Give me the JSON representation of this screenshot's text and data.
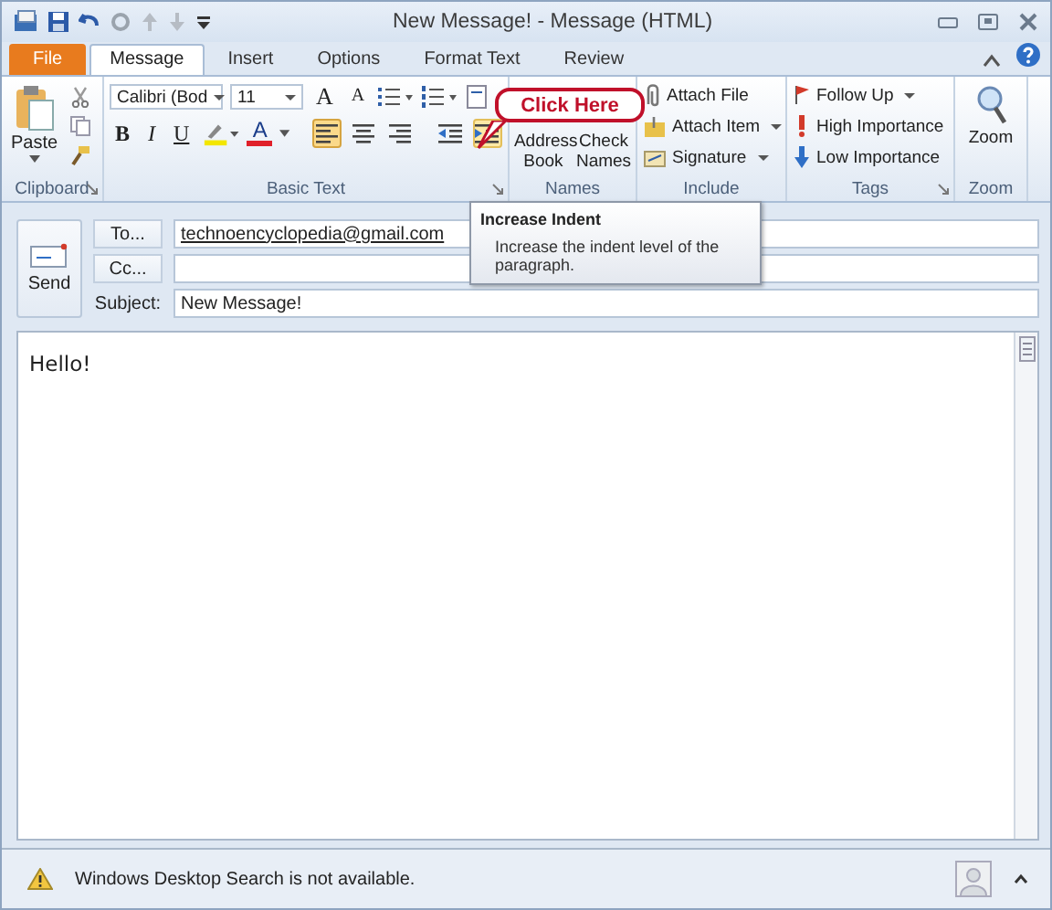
{
  "window": {
    "title": "New Message!  -  Message (HTML)"
  },
  "tabs": [
    {
      "label": "File",
      "kind": "file",
      "selected": false
    },
    {
      "label": "Message",
      "kind": "tab",
      "selected": true
    },
    {
      "label": "Insert",
      "kind": "tab",
      "selected": false
    },
    {
      "label": "Options",
      "kind": "tab",
      "selected": false
    },
    {
      "label": "Format Text",
      "kind": "tab",
      "selected": false
    },
    {
      "label": "Review",
      "kind": "tab",
      "selected": false
    }
  ],
  "ribbon": {
    "clipboard": {
      "paste": "Paste",
      "label": "Clipboard"
    },
    "basic_text": {
      "font": "Calibri (Bod",
      "size": "11",
      "grow": "A",
      "shrink": "A",
      "bold": "B",
      "italic": "I",
      "underline": "U",
      "font_color": "A",
      "label": "Basic Text",
      "alignment": [
        {
          "kind": "left",
          "selected": true
        },
        {
          "kind": "center",
          "selected": false
        },
        {
          "kind": "right",
          "selected": false
        }
      ],
      "indent": [
        {
          "kind": "decrease",
          "hovered": false
        },
        {
          "kind": "increase",
          "hovered": true
        }
      ]
    },
    "names": {
      "buttons": [
        {
          "label": "Address Book"
        },
        {
          "label": "Check Names"
        }
      ],
      "label": "Names"
    },
    "include": {
      "items": [
        {
          "label": "Attach File",
          "kind": "clip",
          "dropdown": false
        },
        {
          "label": "Attach Item",
          "kind": "item",
          "dropdown": true
        },
        {
          "label": "Signature",
          "kind": "signature",
          "dropdown": true
        }
      ],
      "label": "Include"
    },
    "tags": {
      "items": [
        {
          "label": "Follow Up",
          "kind": "flag",
          "dropdown": true
        },
        {
          "label": "High Importance",
          "kind": "high",
          "dropdown": false
        },
        {
          "label": "Low Importance",
          "kind": "low",
          "dropdown": false
        }
      ],
      "label": "Tags"
    },
    "zoom": {
      "button": "Zoom",
      "label": "Zoom"
    }
  },
  "callout": "Click Here",
  "tooltip": {
    "title": "Increase Indent",
    "text": "Increase the indent level of the paragraph."
  },
  "header": {
    "send": "Send",
    "to": {
      "button": "To...",
      "value": "technoencyclopedia@gmail.com"
    },
    "cc": {
      "button": "Cc..."
    },
    "subject": {
      "label": "Subject:",
      "value": "New Message!"
    }
  },
  "body": "Hello!",
  "status": "Windows Desktop Search is not available."
}
